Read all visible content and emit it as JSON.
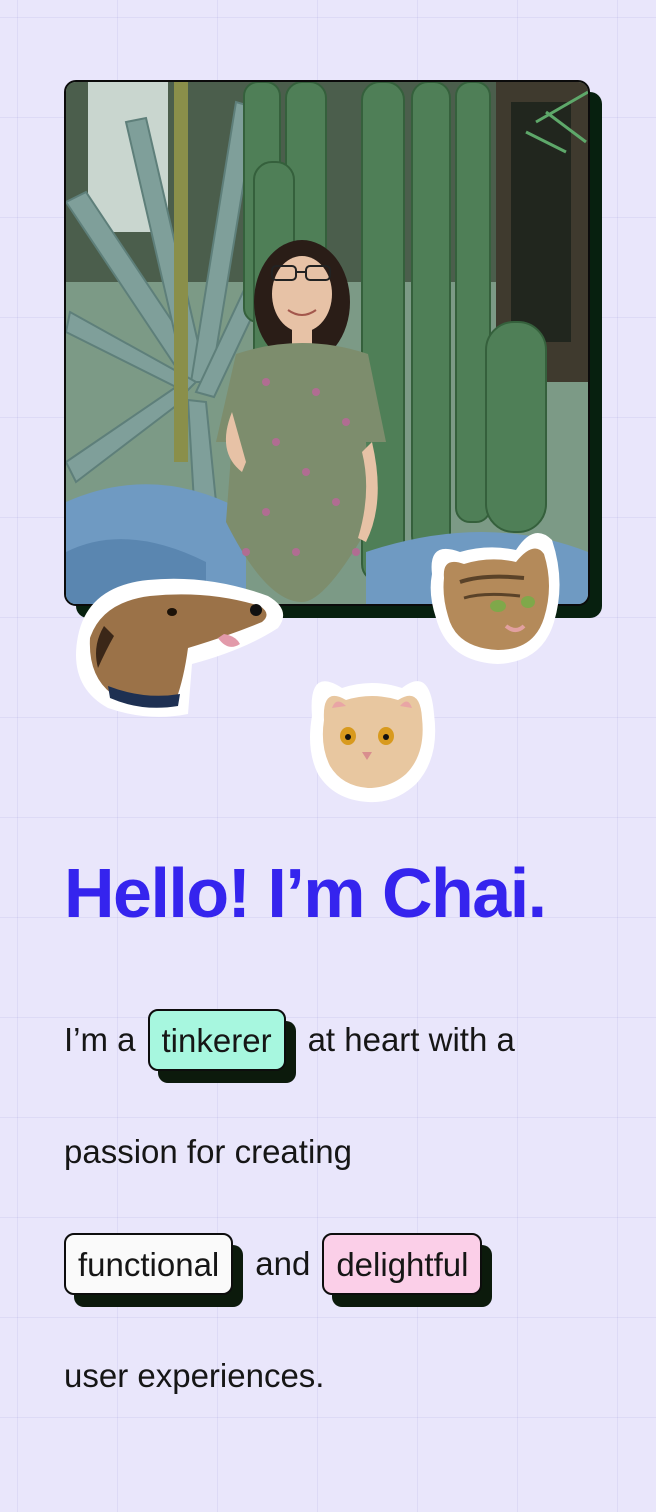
{
  "hero": {
    "photo_description_icon": "portrait-photo",
    "title": "Hello! I’m Chai."
  },
  "pets": {
    "dog_icon": "greyhound-dog-sticker",
    "cat_tabby_icon": "tabby-cat-sticker",
    "cat_orange_icon": "orange-cat-sticker"
  },
  "intro": {
    "line1_prefix": "I’m a",
    "chip_tinkerer": "tinkerer",
    "line1_suffix": "at heart with a",
    "line2": "passion for creating",
    "chip_functional": "functional",
    "line3_and": "and",
    "chip_delightful": "delightful",
    "line4": "user experiences."
  },
  "colors": {
    "background": "#e9e6fb",
    "title": "#3524ee",
    "chip_tinkerer": "#a7f7df",
    "chip_functional": "#fafafa",
    "chip_delightful": "#fbcfe8",
    "shadow": "#0c1a0c"
  }
}
